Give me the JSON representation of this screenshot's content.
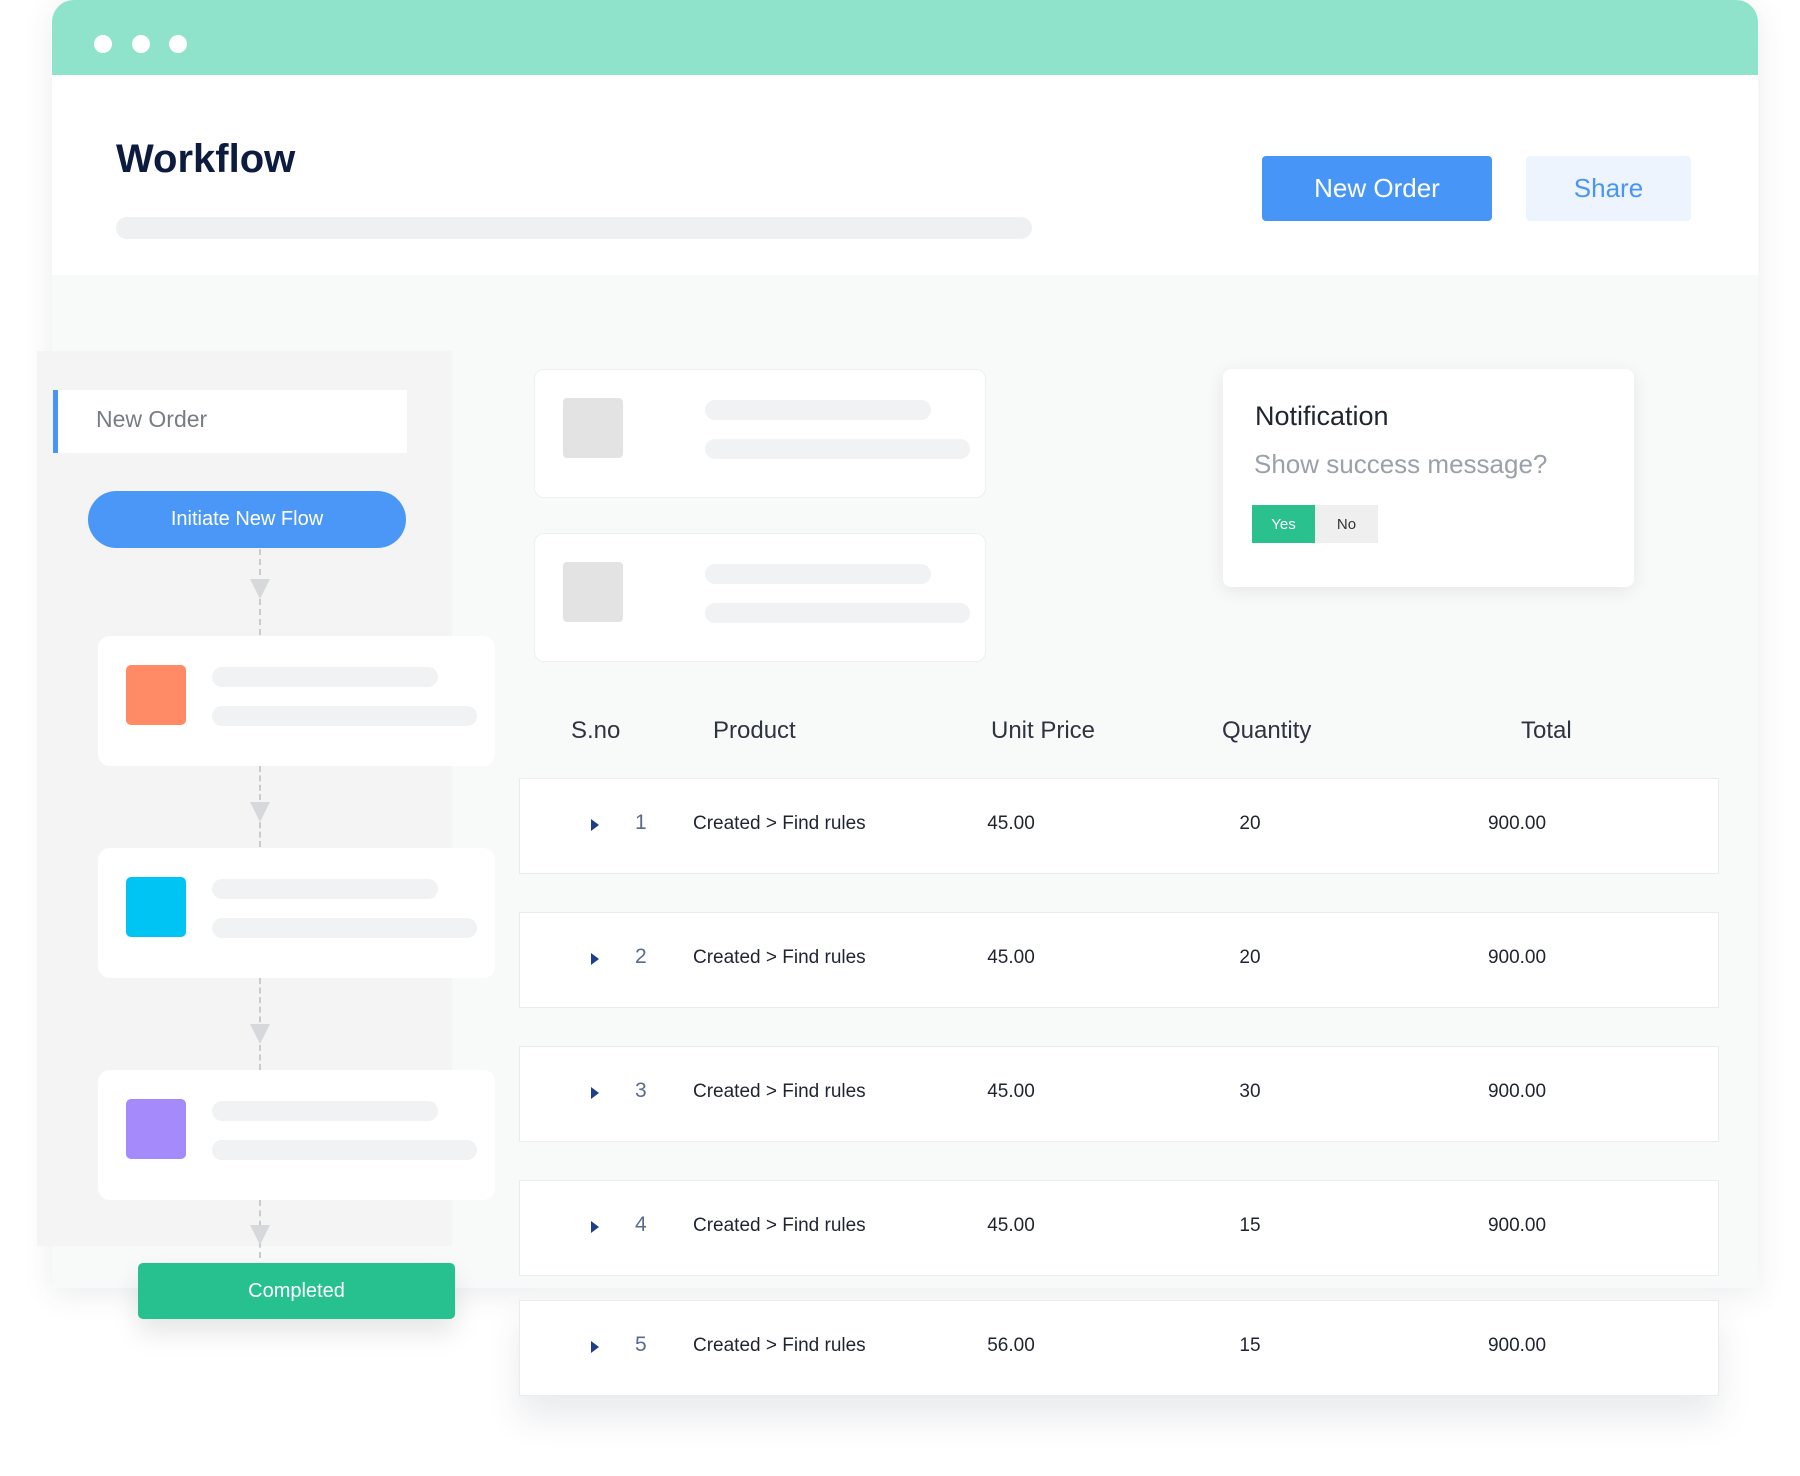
{
  "header": {
    "title": "Workflow",
    "new_order_label": "New Order",
    "share_label": "Share"
  },
  "sidebar": {
    "input_value": "New Order",
    "initiate_label": "Initiate New Flow",
    "completed_label": "Completed",
    "steps": [
      {
        "color": "#ff8a65"
      },
      {
        "color": "#00c4f4"
      },
      {
        "color": "#a48afa"
      }
    ]
  },
  "notification": {
    "title": "Notification",
    "message": "Show success message?",
    "yes_label": "Yes",
    "no_label": "No",
    "selected": "Yes"
  },
  "table": {
    "columns": [
      "S.no",
      "Product",
      "Unit Price",
      "Quantity",
      "Total"
    ],
    "rows": [
      {
        "sno": "1",
        "product": "Created > Find rules",
        "unit_price": "45.00",
        "quantity": "20",
        "total": "900.00"
      },
      {
        "sno": "2",
        "product": "Created > Find rules",
        "unit_price": "45.00",
        "quantity": "20",
        "total": "900.00"
      },
      {
        "sno": "3",
        "product": "Created > Find rules",
        "unit_price": "45.00",
        "quantity": "30",
        "total": "900.00"
      },
      {
        "sno": "4",
        "product": "Created > Find rules",
        "unit_price": "45.00",
        "quantity": "15",
        "total": "900.00"
      },
      {
        "sno": "5",
        "product": "Created > Find rules",
        "unit_price": "56.00",
        "quantity": "15",
        "total": "900.00"
      }
    ]
  },
  "colors": {
    "titlebar": "#8fe3ca",
    "accent_blue": "#4796f7",
    "accent_green": "#27c08f"
  }
}
